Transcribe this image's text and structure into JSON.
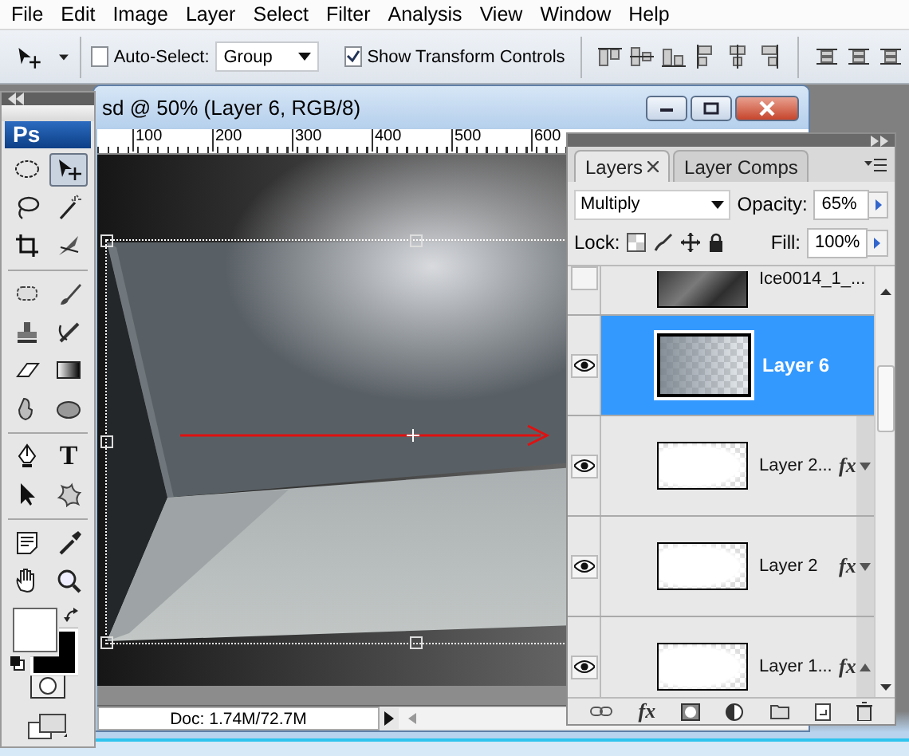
{
  "menu": [
    {
      "label": "File"
    },
    {
      "label": "Edit"
    },
    {
      "label": "Image"
    },
    {
      "label": "Layer"
    },
    {
      "label": "Select"
    },
    {
      "label": "Filter"
    },
    {
      "label": "Analysis"
    },
    {
      "label": "View"
    },
    {
      "label": "Window"
    },
    {
      "label": "Help"
    }
  ],
  "options_bar": {
    "auto_select": {
      "label": "Auto-Select:",
      "checked": false
    },
    "auto_select_mode": "Group",
    "show_transform": {
      "label": "Show Transform Controls",
      "checked": true
    }
  },
  "toolbox": {
    "logo": "Ps",
    "tools": [
      {
        "selected": false
      },
      {
        "selected": true
      },
      {
        "selected": false
      },
      {
        "selected": false
      },
      {
        "selected": false
      },
      {
        "selected": false
      },
      {
        "selected": false
      },
      {
        "selected": false
      },
      {
        "selected": false
      },
      {
        "selected": false
      },
      {
        "selected": false
      },
      {
        "selected": false
      },
      {
        "selected": false
      },
      {
        "selected": false
      },
      {
        "selected": false
      },
      {
        "selected": false,
        "glyph": "T"
      },
      {
        "selected": false
      },
      {
        "selected": false
      },
      {
        "selected": false
      },
      {
        "selected": false
      },
      {
        "selected": false
      },
      {
        "selected": false
      }
    ],
    "swatches": [
      {
        "kind": "foreground",
        "color": "#ffffff"
      },
      {
        "kind": "background",
        "color": "#000000"
      }
    ]
  },
  "document": {
    "title": "sd @ 50% (Layer 6, RGB/8)",
    "ruler": [
      "100",
      "200",
      "300",
      "400",
      "500",
      "600"
    ],
    "status": "Doc: 1.74M/72.7M"
  },
  "layers_panel": {
    "tabs": [
      {
        "label": "Layers",
        "selected": true
      },
      {
        "label": "Layer Comps",
        "selected": false
      }
    ],
    "blend_mode": "Multiply",
    "opacity_label": "Opacity:",
    "opacity": "65%",
    "lock_label": "Lock:",
    "fill_label": "Fill:",
    "fill": "100%",
    "layers": [
      {
        "name": "Ice0014_1_...",
        "visible": false,
        "selected": false,
        "kind": "texture"
      },
      {
        "name": "Layer 6",
        "visible": true,
        "selected": true,
        "kind": "gradient"
      },
      {
        "name": "Layer 2...",
        "visible": true,
        "selected": false,
        "kind": "blank",
        "fx": "fx",
        "expanded": false
      },
      {
        "name": "Layer 2",
        "visible": true,
        "selected": false,
        "kind": "blank",
        "fx": "fx",
        "expanded": false
      },
      {
        "name": "Layer 1...",
        "visible": true,
        "selected": false,
        "kind": "blank",
        "fx": "fx",
        "expanded": true
      }
    ],
    "footer_fx": "fx"
  }
}
